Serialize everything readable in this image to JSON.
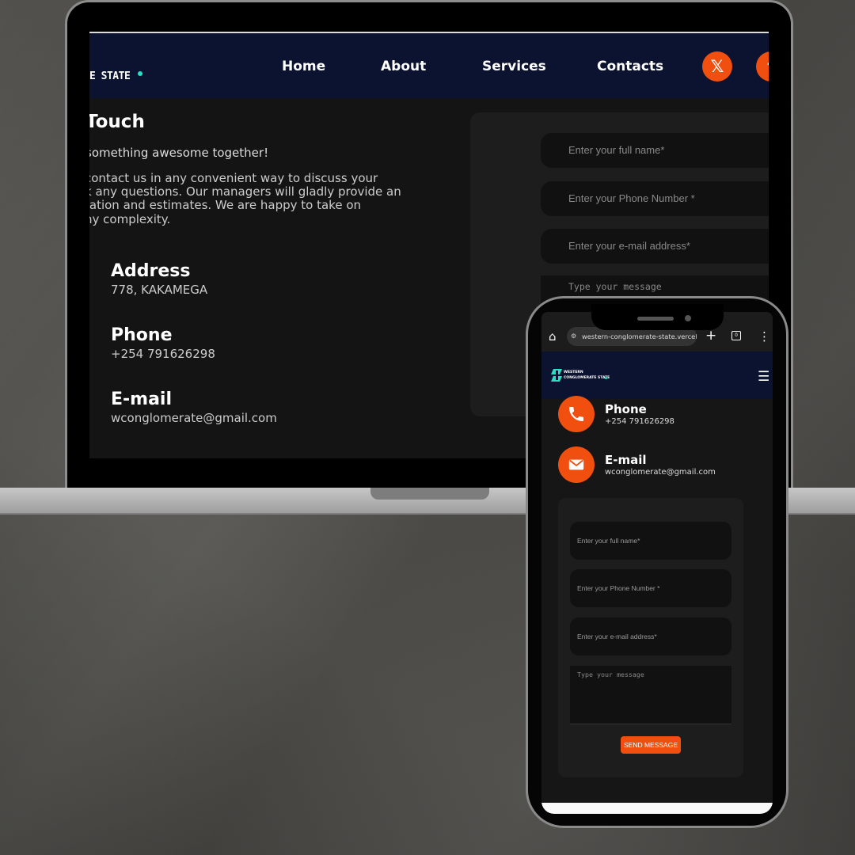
{
  "laptop": {
    "nav": {
      "brand_tail": "E STATE",
      "links": [
        "Home",
        "About",
        "Services",
        "Contacts"
      ],
      "social_icons": [
        "x-icon",
        "facebook-icon"
      ]
    },
    "contact": {
      "title": "Touch",
      "tagline": "something awesome together!",
      "description_lines": [
        "contact us in any convenient way to discuss your",
        "k any questions. Our managers will gladly provide an",
        "tation and estimates. We are happy to take on",
        "ny complexity."
      ],
      "address_title": "Address",
      "address_value": "778, KAKAMEGA",
      "phone_title": "Phone",
      "phone_value": "+254 791626298",
      "email_title": "E-mail",
      "email_value": "wconglomerate@gmail.com"
    },
    "form": {
      "name_placeholder": "Enter your full name*",
      "phone_placeholder": "Enter your Phone Number *",
      "email_placeholder": "Enter your e-mail address*",
      "message_placeholder": "Type your message"
    }
  },
  "phone": {
    "browser": {
      "url": "western-conglomerate-state.vercel.app/",
      "tab_count": "0"
    },
    "nav": {
      "brand_line1": "WESTERN",
      "brand_line2": "CONGLOMERATE STATE"
    },
    "contact": {
      "phone_title": "Phone",
      "phone_value": "+254 791626298",
      "email_title": "E-mail",
      "email_value": "wconglomerate@gmail.com"
    },
    "form": {
      "name_placeholder": "Enter your full name*",
      "phone_placeholder": "Enter your Phone Number *",
      "email_placeholder": "Enter your e-mail address*",
      "message_placeholder": "Type your message",
      "submit_label": "SEND MESSAGE"
    }
  },
  "colors": {
    "accent": "#f04f0f",
    "nav_bg": "#0c1330",
    "teal": "#28e0c6",
    "page_bg": "#141414"
  }
}
